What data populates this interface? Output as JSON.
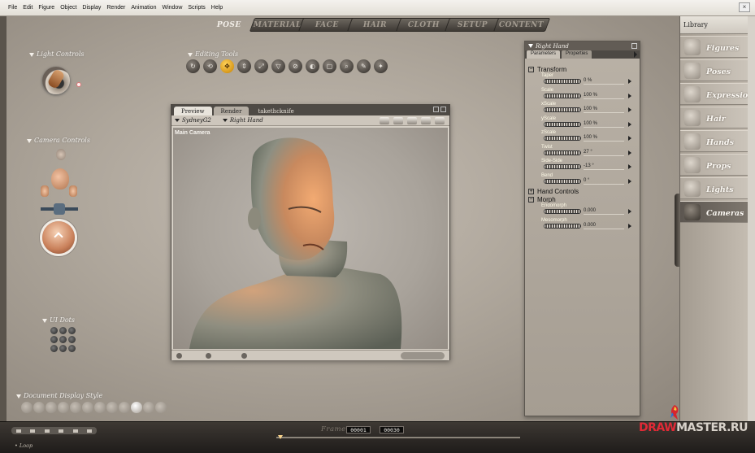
{
  "menu": [
    "File",
    "Edit",
    "Figure",
    "Object",
    "Display",
    "Render",
    "Animation",
    "Window",
    "Scripts",
    "Help"
  ],
  "room_tabs": [
    {
      "label": "POSE",
      "active": true
    },
    {
      "label": "MATERIAL",
      "active": false
    },
    {
      "label": "FACE",
      "active": false
    },
    {
      "label": "HAIR",
      "active": false
    },
    {
      "label": "CLOTH",
      "active": false
    },
    {
      "label": "SETUP",
      "active": false
    },
    {
      "label": "CONTENT",
      "active": false
    }
  ],
  "left_panel": {
    "light_controls": "Light Controls",
    "camera_controls": "Camera Controls",
    "ui_dots": "UI Dots",
    "document_display_style": "Document Display Style"
  },
  "editing_tools": {
    "label": "Editing Tools",
    "tools": [
      "rotate-tool-icon",
      "twist-tool-icon",
      "translate-tool-icon",
      "translate-in-out-tool-icon",
      "scale-tool-icon",
      "taper-tool-icon",
      "chain-break-tool-icon",
      "color-tool-icon",
      "grouping-tool-icon",
      "view-magnifier-tool-icon",
      "morphing-tool-icon",
      "direct-manipulation-tool-icon"
    ]
  },
  "document": {
    "tabs": {
      "preview": "Preview",
      "render": "Render",
      "extra": "takethcknife"
    },
    "figure_selector": "SydneyG2",
    "actor_selector": "Right Hand",
    "camera_label": "Main Camera"
  },
  "params": {
    "title": "Right Hand",
    "tab_parameters": "Parameters",
    "tab_properties": "Properties",
    "group_transform": "Transform",
    "transform_items": [
      {
        "name": "Taper",
        "value": "0 %"
      },
      {
        "name": "Scale",
        "value": "100 %"
      },
      {
        "name": "xScale",
        "value": "100 %"
      },
      {
        "name": "yScale",
        "value": "100 %"
      },
      {
        "name": "zScale",
        "value": "100 %"
      },
      {
        "name": "Twist",
        "value": "27 °"
      },
      {
        "name": "Side-Side",
        "value": "-13 °"
      },
      {
        "name": "Bend",
        "value": "0 °"
      }
    ],
    "group_hand_controls": "Hand Controls",
    "group_morph": "Morph",
    "morph_items": [
      {
        "name": "Endomorph",
        "value": "0.000"
      },
      {
        "name": "Mesomorph",
        "value": "0.000"
      }
    ]
  },
  "library": {
    "title": "Library",
    "items": [
      "Figures",
      "Poses",
      "Expression",
      "Hair",
      "Hands",
      "Props",
      "Lights",
      "Cameras"
    ],
    "active": "Cameras"
  },
  "animbar": {
    "frame_label": "Frame",
    "current_frame": "00001",
    "total_frames": "00030",
    "loop_label": "Loop"
  },
  "watermark": {
    "part1": "DRAW",
    "part2": "MASTER.RU"
  }
}
